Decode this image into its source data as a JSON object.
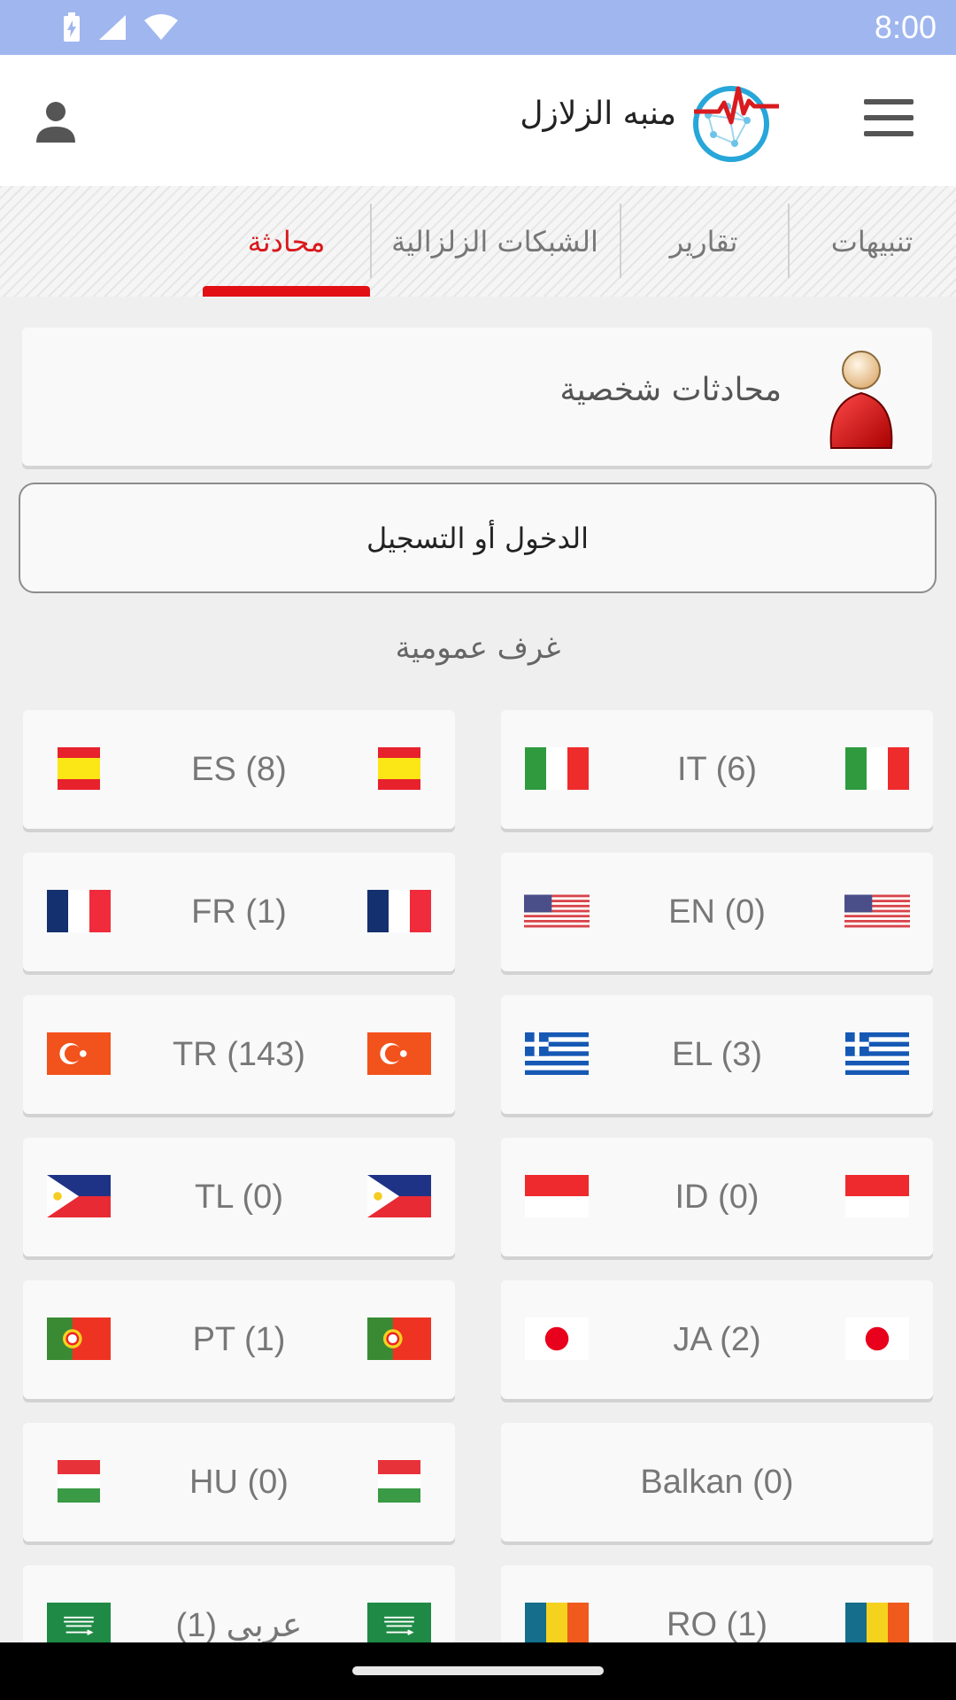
{
  "status": {
    "time": "8:00"
  },
  "header": {
    "title": "منبه الزلازل"
  },
  "tabs": [
    {
      "label": "تنبيهات"
    },
    {
      "label": "تقارير"
    },
    {
      "label": "الشبكات الزلزالية"
    },
    {
      "label": "محادثة",
      "active": true
    }
  ],
  "personal": {
    "label": "محادثات شخصية"
  },
  "login": {
    "label": "الدخول أو التسجيل"
  },
  "rooms_title": "غرف عمومية",
  "rooms": [
    {
      "label": "IT (6)",
      "flag": "italy-flag-icon"
    },
    {
      "label": "ES (8)",
      "flag": "spain-flag-icon"
    },
    {
      "label": "EN (0)",
      "flag": "usa-flag-icon"
    },
    {
      "label": "FR (1)",
      "flag": "france-flag-icon"
    },
    {
      "label": "EL (3)",
      "flag": "greece-flag-icon"
    },
    {
      "label": "TR (143)",
      "flag": "turkey-flag-icon"
    },
    {
      "label": "ID (0)",
      "flag": "indonesia-flag-icon"
    },
    {
      "label": "TL (0)",
      "flag": "philippines-flag-icon"
    },
    {
      "label": "JA (2)",
      "flag": "japan-flag-icon"
    },
    {
      "label": "PT (1)",
      "flag": "portugal-flag-icon"
    },
    {
      "label": "Balkan (0)",
      "flag": ""
    },
    {
      "label": "HU (0)",
      "flag": "hungary-flag-icon"
    },
    {
      "label": "RO (1)",
      "flag": "romania-flag-icon"
    },
    {
      "label": "عربي (1)",
      "flag": "saudi-flag-icon"
    }
  ],
  "colors": {
    "status_bar": "#9fb6ef",
    "accent": "#e20f14"
  }
}
